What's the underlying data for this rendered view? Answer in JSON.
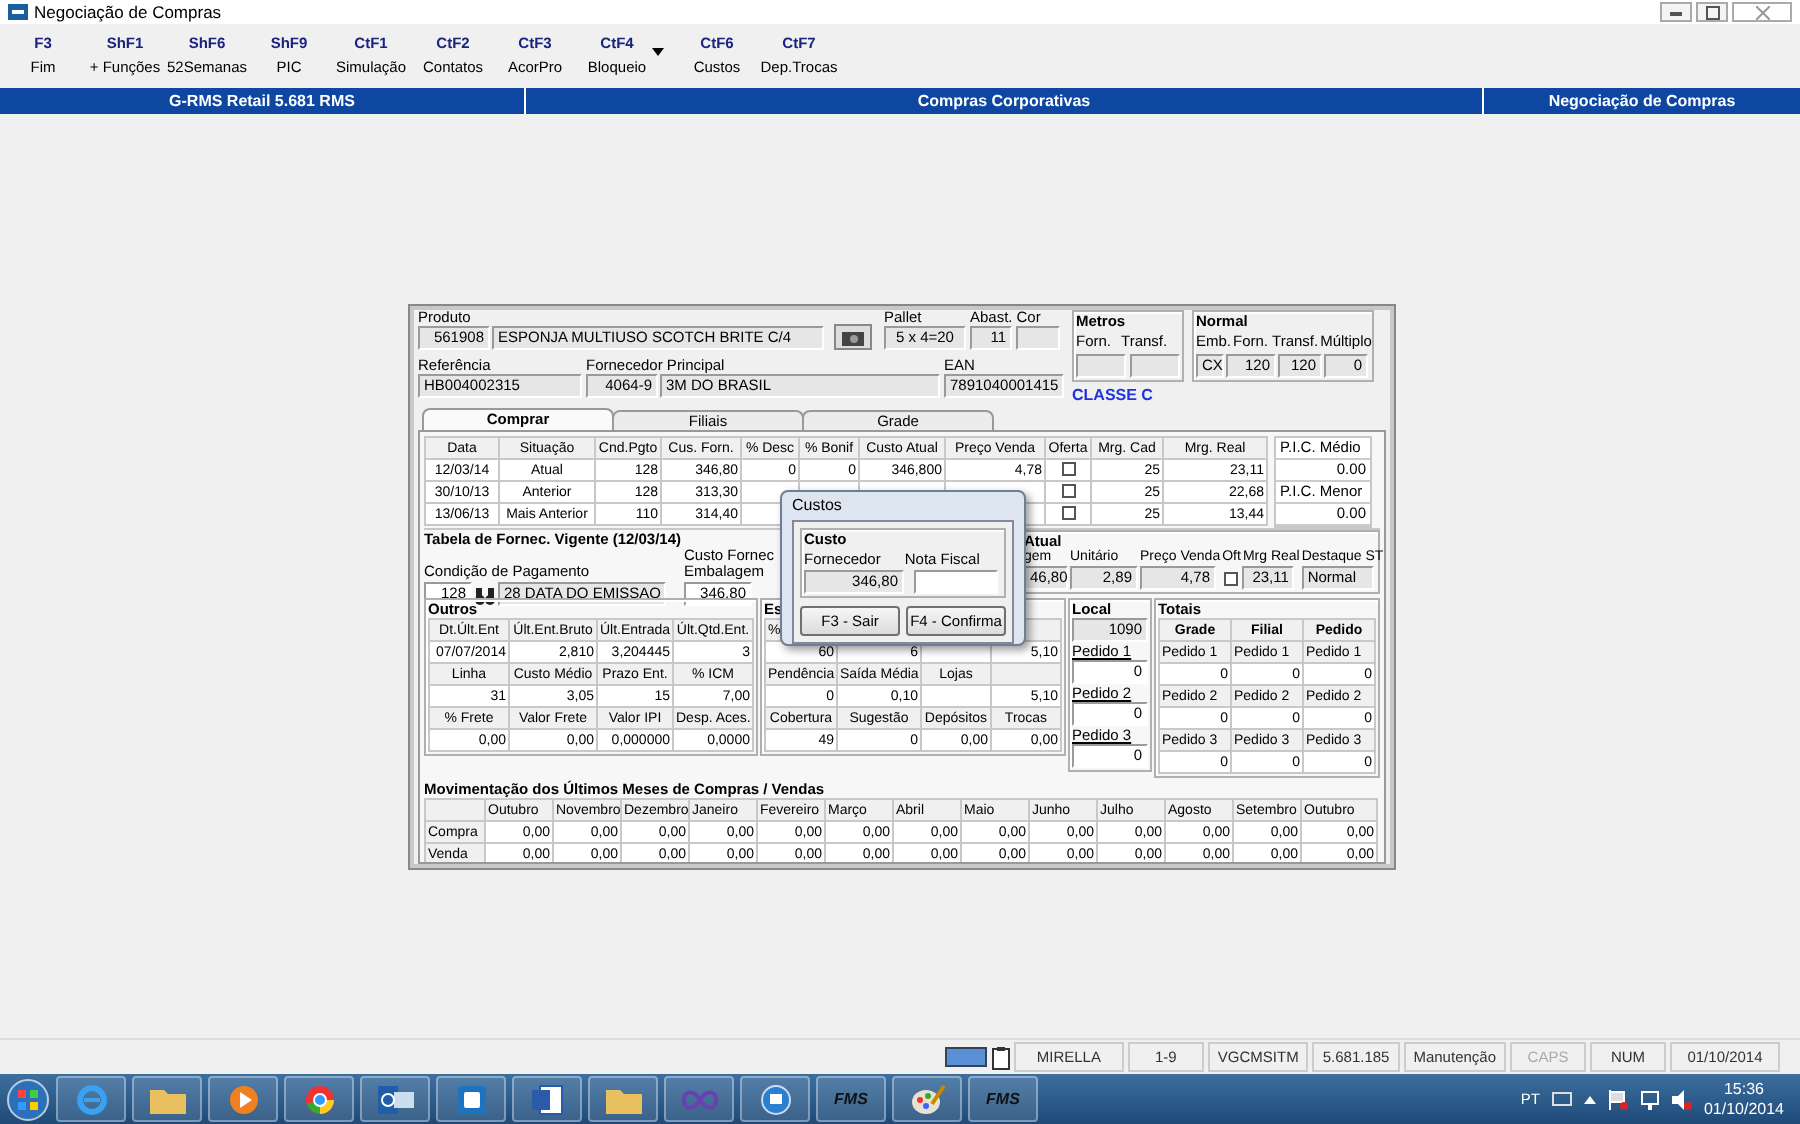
{
  "window": {
    "title": "Negociação de Compras"
  },
  "toolbar": [
    {
      "key": "F3",
      "label": "Fim",
      "has_menu": false
    },
    {
      "key": "ShF1",
      "label": "+ Funções",
      "has_menu": false
    },
    {
      "key": "ShF6",
      "label": "52Semanas",
      "has_menu": false
    },
    {
      "key": "ShF9",
      "label": "PIC",
      "has_menu": false
    },
    {
      "key": "CtF1",
      "label": "Simulação",
      "has_menu": false
    },
    {
      "key": "CtF2",
      "label": "Contatos",
      "has_menu": false
    },
    {
      "key": "CtF3",
      "label": "AcorPro",
      "has_menu": false
    },
    {
      "key": "CtF4",
      "label": "Bloqueio",
      "has_menu": true
    },
    {
      "key": "CtF6",
      "label": "Custos",
      "has_menu": false
    },
    {
      "key": "CtF7",
      "label": "Dep.Trocas",
      "has_menu": false
    }
  ],
  "header_bar": {
    "left": "G-RMS Retail 5.681 RMS",
    "center": "Compras Corporativas",
    "right": "Negociação de Compras"
  },
  "product": {
    "produto_label": "Produto",
    "codigo": "561908",
    "descricao": "ESPONJA MULTIUSO SCOTCH BRITE C/4",
    "pallet_label": "Pallet",
    "pallet": "5 x 4=20",
    "abast_label": "Abast.",
    "abast": "11",
    "cor_label": "Cor",
    "metros": {
      "title": "Metros",
      "forn_label": "Forn.",
      "transf_label": "Transf."
    },
    "normal": {
      "title": "Normal",
      "emb_label": "Emb.",
      "forn_label": "Forn.",
      "transf_label": "Transf.",
      "multiplo_label": "Múltiplo",
      "emb": "CX",
      "forn": "120",
      "transf": "120",
      "multiplo": "0"
    },
    "referencia_label": "Referência",
    "referencia": "HB004002315",
    "fornecedor_label": "Fornecedor Principal",
    "fornecedor_codigo": "4064-9",
    "fornecedor_nome": "3M DO BRASIL",
    "ean_label": "EAN",
    "ean": "7891040001415",
    "classe": "CLASSE C"
  },
  "tabs": [
    {
      "label": "Comprar",
      "selected": true
    },
    {
      "label": "Filiais",
      "selected": false
    },
    {
      "label": "Grade",
      "selected": false
    }
  ],
  "table": {
    "columns": [
      "Data",
      "Situação",
      "Cnd.Pgto",
      "Cus. Forn.",
      "% Desc",
      "% Bonif",
      "Custo Atual",
      "Preço Venda",
      "Oferta",
      "Mrg. Cad",
      "Mrg. Real"
    ],
    "rows": [
      {
        "data": "12/03/14",
        "situacao": "Atual",
        "cnd_pgto": "128",
        "cus_forn": "346,80",
        "desc": "0",
        "bonif": "0",
        "custo_atual": "346,800",
        "preco_venda": "4,78",
        "oferta": false,
        "mrg_cad": "25",
        "mrg_real": "23,11"
      },
      {
        "data": "30/10/13",
        "situacao": "Anterior",
        "cnd_pgto": "128",
        "cus_forn": "313,30",
        "oferta": false,
        "mrg_cad": "25",
        "mrg_real": "22,68"
      },
      {
        "data": "13/06/13",
        "situacao": "Mais Anterior",
        "cnd_pgto": "110",
        "cus_forn": "314,40",
        "oferta": false,
        "mrg_cad": "25",
        "mrg_real": "13,44"
      }
    ]
  },
  "pic": {
    "medio_label": "P.I.C. Médio",
    "medio": "0.00",
    "menor_label": "P.I.C. Menor",
    "menor": "0.00"
  },
  "tabela_fornec": {
    "title": "Tabela de Fornec. Vigente (12/03/14)",
    "condicao_label": "Condição de Pagamento",
    "condicao": "128",
    "condicao_desc": "28 DATA DO EMISSAO",
    "custo_label": "Custo Fornec",
    "embalagem_label": "Embalagem",
    "embalagem": "346,80",
    "atual": {
      "title": "Atual",
      "embalagem_label": "gem",
      "embalagem": "46,80",
      "unitario_label": "Unitário",
      "unitario": "2,89",
      "preco_label": "Preço Venda",
      "preco": "4,78",
      "oft_label": "Oft",
      "oft": false,
      "mrg_label": "Mrg Real",
      "mrg": "23,11",
      "destaque_label": "Destaque ST",
      "destaque": "Normal"
    }
  },
  "outros": {
    "title": "Outros",
    "rows": [
      [
        "Dt.Últ.Ent",
        "Últ.Ent.Bruto",
        "Últ.Entrada",
        "Últ.Qtd.Ent."
      ],
      [
        "07/07/2014",
        "2,810",
        "3,204445",
        "3"
      ],
      [
        "Linha",
        "Custo Médio",
        "Prazo Ent.",
        "% ICM"
      ],
      [
        "31",
        "3,05",
        "15",
        "7,00"
      ],
      [
        "% Frete",
        "Valor Frete",
        "Valor IPI",
        "Desp. Aces."
      ],
      [
        "0,00",
        "0,00",
        "0,000000",
        "0,0000"
      ]
    ]
  },
  "estoque": {
    "title": "Es",
    "rows": [
      {
        "kind": "header",
        "cells": [
          "%",
          null,
          null,
          null
        ]
      },
      {
        "kind": "value",
        "cells": [
          "60",
          "6",
          null,
          "5,10"
        ]
      },
      {
        "kind": "header",
        "cells": [
          "Pendência",
          "Saída Média",
          "Lojas",
          null
        ]
      },
      {
        "kind": "value",
        "cells": [
          "0",
          "0,10",
          null,
          "5,10"
        ]
      },
      {
        "kind": "header",
        "cells": [
          "Cobertura",
          "Sugestão",
          "Depósitos",
          "Trocas"
        ]
      },
      {
        "kind": "value",
        "cells": [
          "49",
          "0",
          "0,00",
          "0,00"
        ]
      }
    ]
  },
  "local": {
    "title": "Local",
    "total": "1090",
    "pedidos": [
      {
        "label": "Pedido 1",
        "value": "0"
      },
      {
        "label": "Pedido 2",
        "value": "0"
      },
      {
        "label": "Pedido 3",
        "value": "0"
      }
    ]
  },
  "totais": {
    "title": "Totais",
    "columns": [
      "Grade",
      "Filial",
      "Pedido"
    ],
    "rows": [
      {
        "labels": [
          "Pedido 1",
          "Pedido 1",
          "Pedido 1"
        ],
        "values": [
          "0",
          "0",
          "0"
        ]
      },
      {
        "labels": [
          "Pedido 2",
          "Pedido 2",
          "Pedido 2"
        ],
        "values": [
          "0",
          "0",
          "0"
        ]
      },
      {
        "labels": [
          "Pedido 3",
          "Pedido 3",
          "Pedido 3"
        ],
        "values": [
          "0",
          "0",
          "0"
        ]
      }
    ]
  },
  "movimentacao": {
    "title": "Movimentação dos Últimos Meses de Compras / Vendas",
    "months": [
      "Outubro",
      "Novembro",
      "Dezembro",
      "Janeiro",
      "Fevereiro",
      "Março",
      "Abril",
      "Maio",
      "Junho",
      "Julho",
      "Agosto",
      "Setembro",
      "Outubro"
    ],
    "rows": [
      {
        "label": "Compra",
        "values": [
          "0,00",
          "0,00",
          "0,00",
          "0,00",
          "0,00",
          "0,00",
          "0,00",
          "0,00",
          "0,00",
          "0,00",
          "0,00",
          "0,00",
          "0,00"
        ]
      },
      {
        "label": "Venda",
        "values": [
          "0,00",
          "0,00",
          "0,00",
          "0,00",
          "0,00",
          "0,00",
          "0,00",
          "0,00",
          "0,00",
          "0,00",
          "0,00",
          "0,00",
          "0,00"
        ]
      }
    ]
  },
  "dialog": {
    "title": "Custos",
    "group": "Custo",
    "fornecedor_label": "Fornecedor",
    "fornecedor": "346,80",
    "nota_label": "Nota Fiscal",
    "buttons": [
      "F3 - Sair",
      "F4 - Confirma"
    ]
  },
  "status_bar": [
    {
      "text": "MIRELLA",
      "disabled": false
    },
    {
      "text": "1-9",
      "disabled": false
    },
    {
      "text": "VGCMSITM",
      "disabled": false
    },
    {
      "text": "5.681.185",
      "disabled": false
    },
    {
      "text": "Manutenção",
      "disabled": false
    },
    {
      "text": "CAPS",
      "disabled": true
    },
    {
      "text": "NUM",
      "disabled": false
    },
    {
      "text": "01/10/2014",
      "disabled": false
    }
  ],
  "taskbar": {
    "fms_labels": [
      "FMS",
      "FMS"
    ],
    "language": "PT",
    "time": "15:36",
    "date": "01/10/2014"
  }
}
